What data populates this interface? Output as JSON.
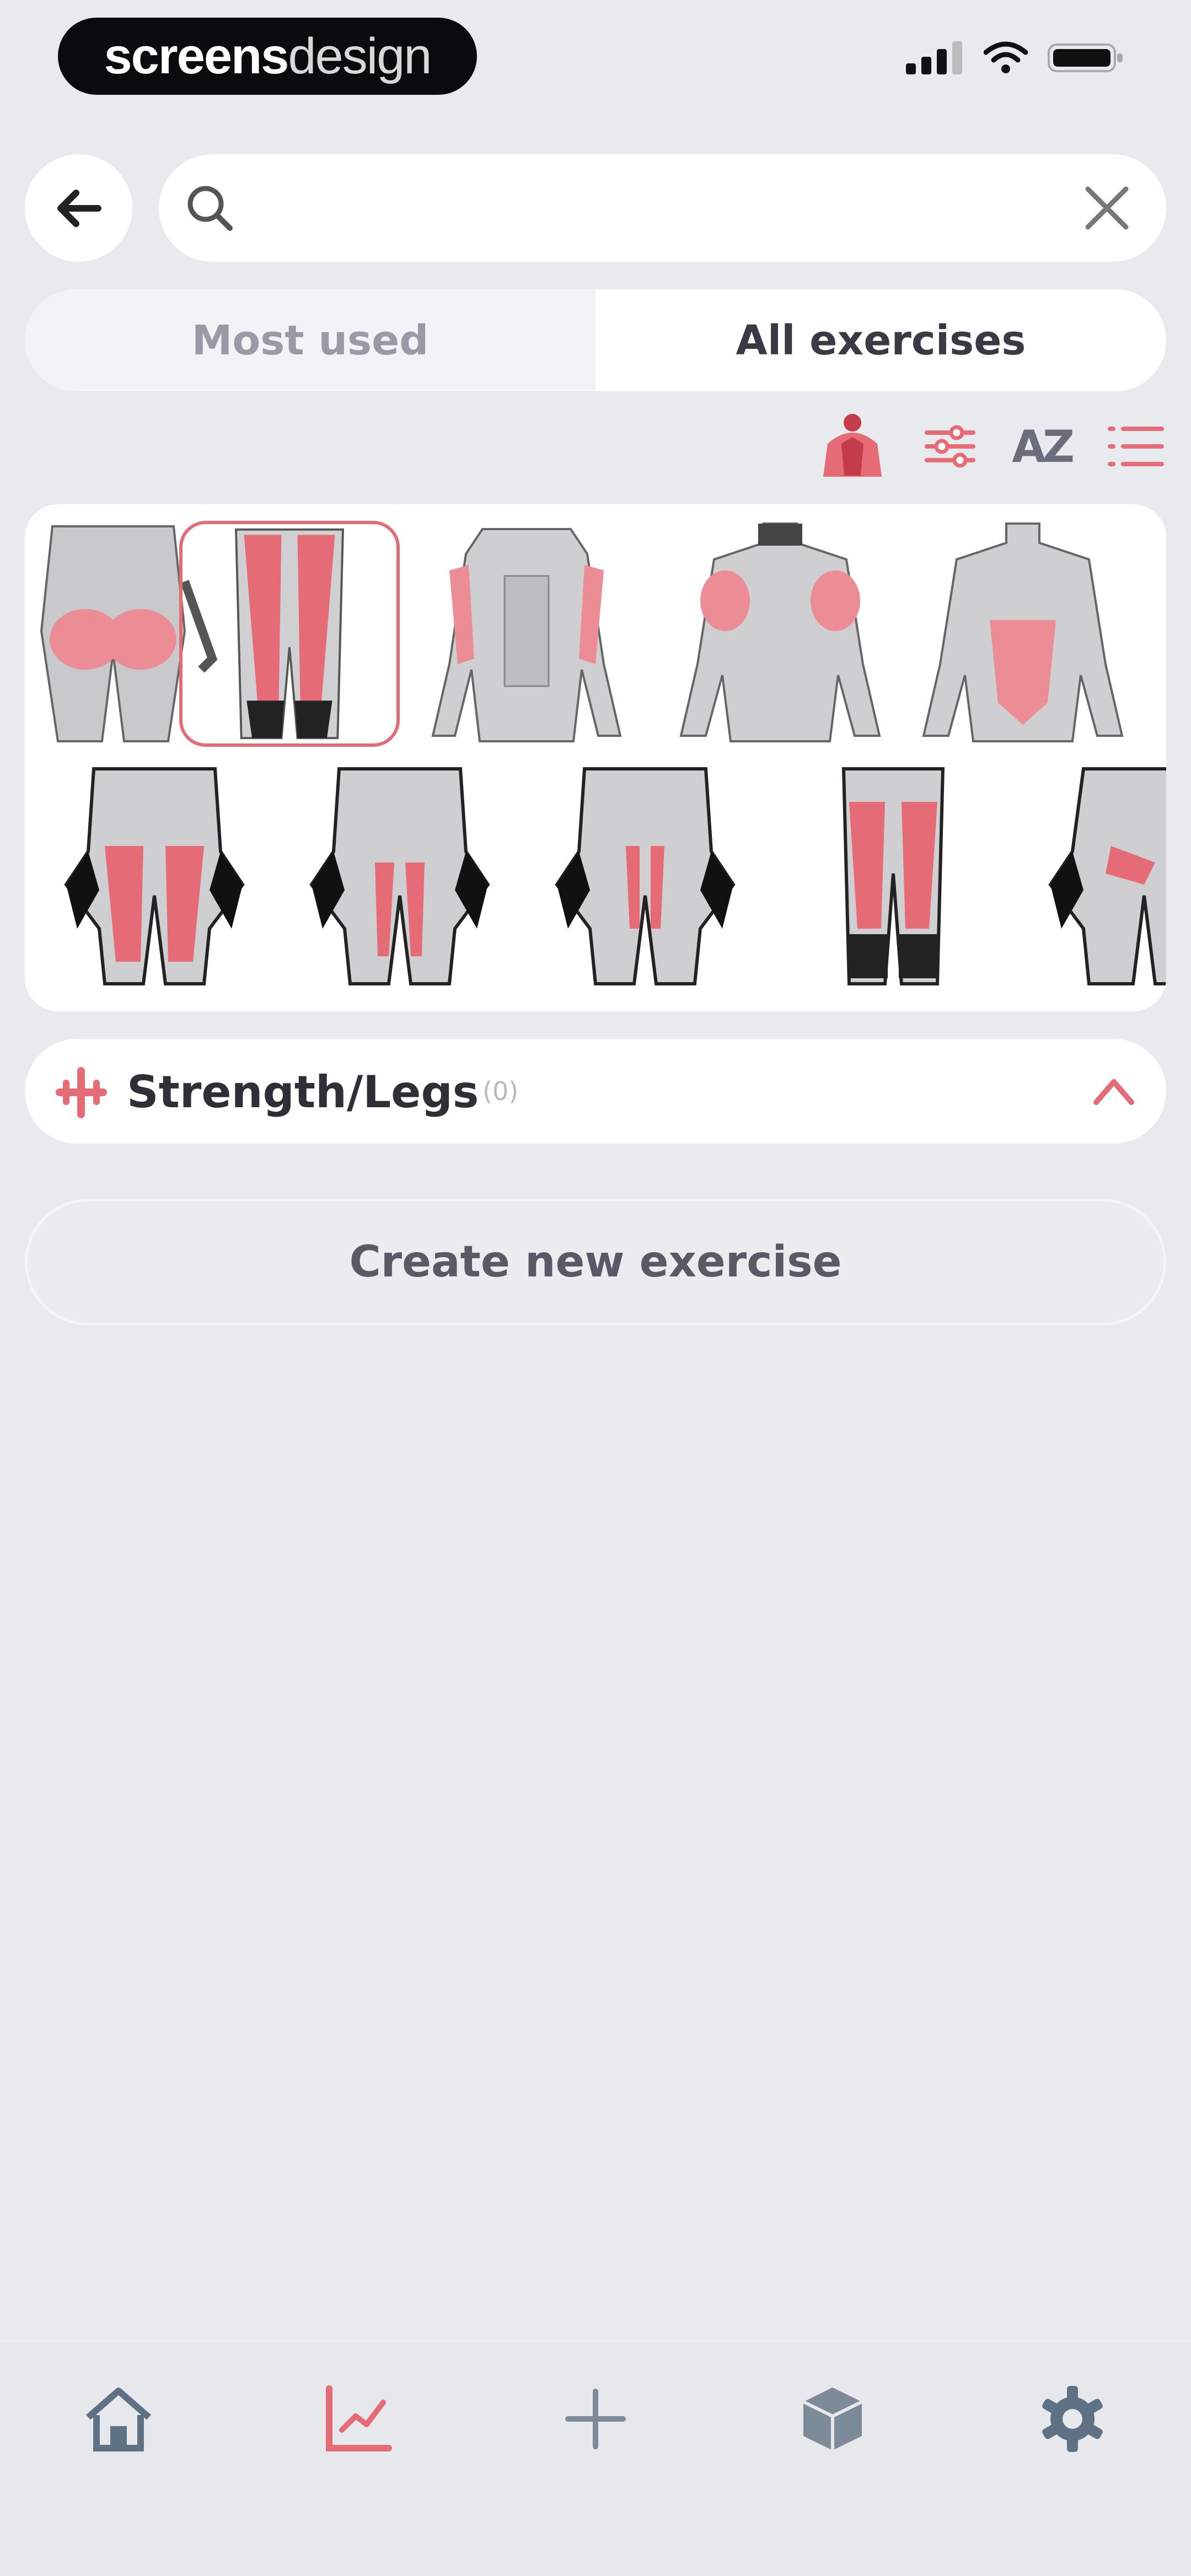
{
  "status_bar": {
    "brand_bold": "screens",
    "brand_light": "design"
  },
  "search": {
    "placeholder": "",
    "value": ""
  },
  "tabs": {
    "most_used": "Most used",
    "all_exercises": "All exercises",
    "active": "All exercises"
  },
  "toolbar": {
    "icons": [
      "muscle-body-icon",
      "filter-sliders-icon",
      "sort-az-icon",
      "list-view-icon"
    ],
    "sort_label": "AZ"
  },
  "muscle_grid": {
    "selected_index": 1,
    "rows": [
      [
        "glutes-rear",
        "quads-front",
        "arms-front",
        "shoulders-back",
        "abs-front"
      ],
      [
        "outer-thigh",
        "inner-thigh",
        "adductors",
        "calves",
        "hip-flexors"
      ]
    ]
  },
  "group": {
    "title": "Strength/Legs",
    "count": "(0)",
    "expanded": true
  },
  "create_button": {
    "label": "Create new exercise"
  },
  "bottom_nav": {
    "items": [
      "home-icon",
      "stats-chart-icon",
      "plus-icon",
      "cube-icon",
      "gear-icon"
    ],
    "active": "stats-chart-icon"
  },
  "colors": {
    "accent": "#e56b77",
    "background": "#e9eaee",
    "card": "#ffffff",
    "nav_icon": "#5f7184"
  }
}
